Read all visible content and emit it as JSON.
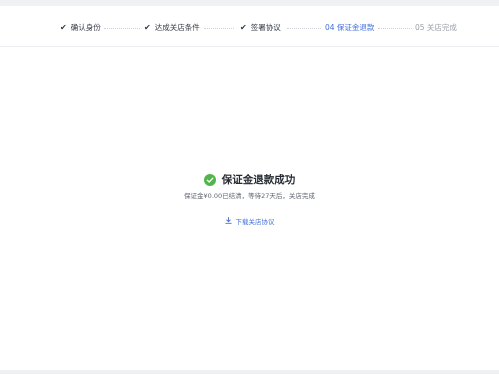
{
  "steps": [
    {
      "label": "确认身份",
      "status": "done",
      "check": "✔"
    },
    {
      "label": "达成关店条件",
      "status": "done",
      "check": "✔"
    },
    {
      "label": "签署协议",
      "status": "done",
      "check": "✔"
    },
    {
      "label": "04 保证金退款",
      "status": "current"
    },
    {
      "label": "05 关店完成",
      "status": "pending"
    }
  ],
  "result": {
    "icon": "check-circle-icon",
    "title": "保证金退款成功",
    "description": "保证金¥0.00已结清，等待27天后，关店完成"
  },
  "download": {
    "icon": "download-icon",
    "label": "下载关店协议"
  },
  "colors": {
    "accent": "#3f6fd8",
    "success": "#52b44a",
    "pending": "#9aa0a8"
  }
}
